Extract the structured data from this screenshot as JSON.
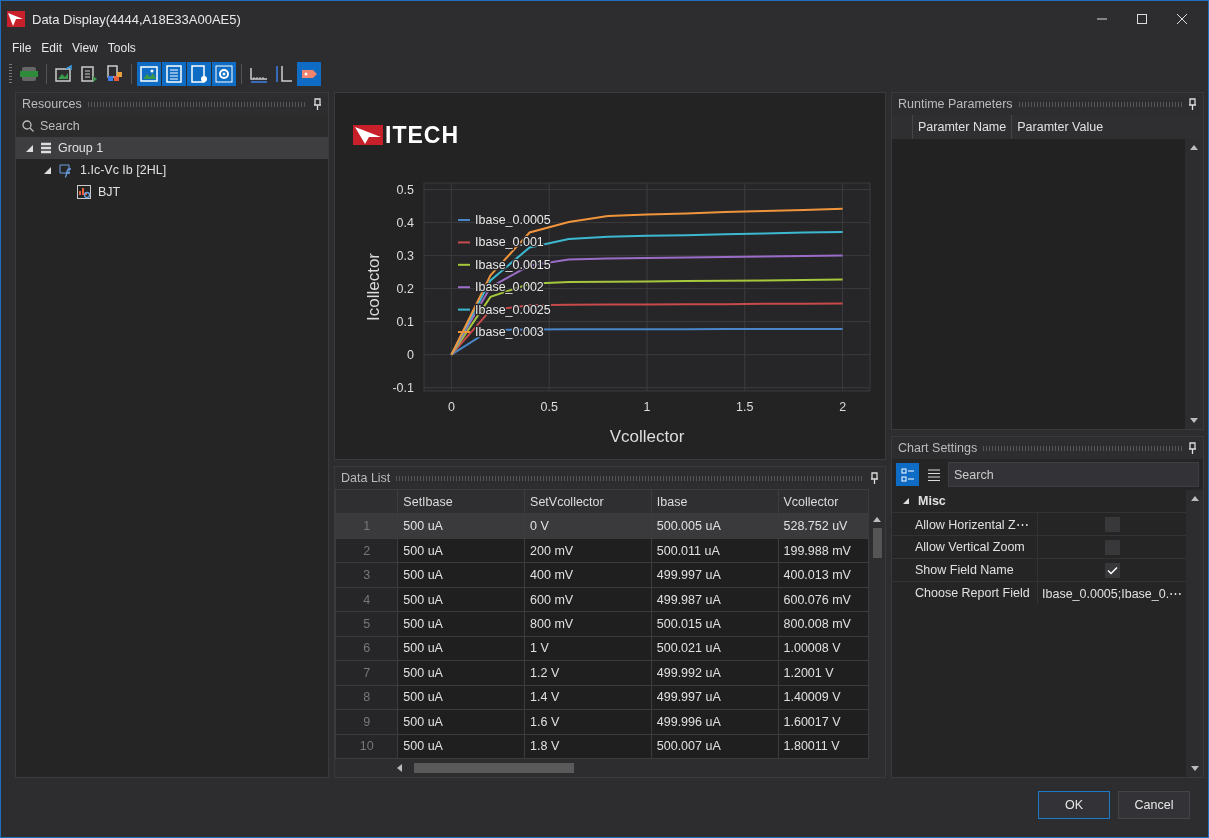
{
  "window": {
    "title": "Data Display(4444,A18E33A00AE5)"
  },
  "menu": [
    "File",
    "Edit",
    "View",
    "Tools"
  ],
  "toolbar": [
    {
      "on": false
    },
    {
      "on": false
    },
    {
      "on": false
    },
    {
      "on": false
    },
    {
      "on": true
    },
    {
      "on": true
    },
    {
      "on": true
    },
    {
      "on": true
    },
    {
      "on": false
    },
    {
      "on": false
    },
    {
      "on": true
    }
  ],
  "resources": {
    "title": "Resources",
    "search": {
      "placeholder": "Search"
    },
    "tree": [
      {
        "kind": "group",
        "label": "Group 1",
        "selected": true,
        "expanded": true,
        "children": [
          {
            "kind": "test",
            "label": "1.Ic-Vc Ib [2HL]",
            "selected": false,
            "expanded": true,
            "children": [
              {
                "kind": "chart",
                "label": "BJT",
                "selected": false
              }
            ]
          }
        ]
      }
    ]
  },
  "chart_panel": {
    "logo": "ITECH",
    "chart_data": {
      "type": "line",
      "grid": true,
      "legend": true,
      "xlabel": "Vcollector",
      "ylabel": "Icollector",
      "x": [
        0,
        0.2,
        0.4,
        0.6,
        0.8,
        1,
        1.2,
        1.4,
        1.6,
        1.8,
        2
      ],
      "xlim": [
        -0.14,
        2.14
      ],
      "ylim": [
        -0.11,
        0.52
      ],
      "xticks": [
        0,
        0.5,
        1,
        1.5,
        2
      ],
      "yticks": [
        -0.1,
        0,
        0.1,
        0.2,
        0.3,
        0.4,
        0.5
      ],
      "series": [
        {
          "name": "Ibase_0.0005",
          "color": "#4a86c8",
          "values": [
            0,
            0.075,
            0.076,
            0.077,
            0.077,
            0.077,
            0.077,
            0.078,
            0.078,
            0.078,
            0.078
          ]
        },
        {
          "name": "Ibase_0.001",
          "color": "#c84a4a",
          "values": [
            0,
            0.135,
            0.15,
            0.151,
            0.152,
            0.152,
            0.153,
            0.153,
            0.154,
            0.154,
            0.155
          ]
        },
        {
          "name": "Ibase_0.0015",
          "color": "#a6c83c",
          "values": [
            0,
            0.175,
            0.215,
            0.22,
            0.221,
            0.222,
            0.223,
            0.224,
            0.225,
            0.226,
            0.228
          ]
        },
        {
          "name": "Ibase_0.002",
          "color": "#9a6cc8",
          "values": [
            0,
            0.205,
            0.27,
            0.288,
            0.291,
            0.293,
            0.294,
            0.296,
            0.297,
            0.299,
            0.3
          ]
        },
        {
          "name": "Ibase_0.0025",
          "color": "#3cb8d0",
          "values": [
            0,
            0.225,
            0.325,
            0.35,
            0.357,
            0.36,
            0.362,
            0.365,
            0.367,
            0.37,
            0.372
          ]
        },
        {
          "name": "Ibase_0.003",
          "color": "#f0943c",
          "values": [
            0,
            0.24,
            0.37,
            0.402,
            0.42,
            0.425,
            0.428,
            0.432,
            0.435,
            0.438,
            0.442
          ]
        }
      ]
    }
  },
  "data_list": {
    "title": "Data List",
    "columns": [
      "SetIbase",
      "SetVcollector",
      "Ibase",
      "Vcollector"
    ],
    "rows": [
      {
        "index": "1",
        "selected": true,
        "cells": [
          "500 uA",
          "0 V",
          "500.005 uA",
          "528.752 uV"
        ]
      },
      {
        "index": "2",
        "selected": false,
        "cells": [
          "500 uA",
          "200 mV",
          "500.011 uA",
          "199.988 mV"
        ]
      },
      {
        "index": "3",
        "selected": false,
        "cells": [
          "500 uA",
          "400 mV",
          "499.997 uA",
          "400.013 mV"
        ]
      },
      {
        "index": "4",
        "selected": false,
        "cells": [
          "500 uA",
          "600 mV",
          "499.987 uA",
          "600.076 mV"
        ]
      },
      {
        "index": "5",
        "selected": false,
        "cells": [
          "500 uA",
          "800 mV",
          "500.015 uA",
          "800.008 mV"
        ]
      },
      {
        "index": "6",
        "selected": false,
        "cells": [
          "500 uA",
          "1 V",
          "500.021 uA",
          "1.00008 V"
        ]
      },
      {
        "index": "7",
        "selected": false,
        "cells": [
          "500 uA",
          "1.2 V",
          "499.992 uA",
          "1.2001 V"
        ]
      },
      {
        "index": "8",
        "selected": false,
        "cells": [
          "500 uA",
          "1.4 V",
          "499.997 uA",
          "1.40009 V"
        ]
      },
      {
        "index": "9",
        "selected": false,
        "cells": [
          "500 uA",
          "1.6 V",
          "499.996 uA",
          "1.60017 V"
        ]
      },
      {
        "index": "10",
        "selected": false,
        "cells": [
          "500 uA",
          "1.8 V",
          "500.007 uA",
          "1.80011 V"
        ]
      }
    ]
  },
  "runtime_parameters": {
    "title": "Runtime Parameters",
    "columns": [
      "Paramter Name",
      "Paramter Value"
    ]
  },
  "chart_settings": {
    "title": "Chart Settings",
    "views": [
      {
        "kind": "categorized",
        "selected": true
      },
      {
        "kind": "alphabetical",
        "selected": false
      }
    ],
    "search": {
      "placeholder": "Search"
    },
    "category": {
      "label": "Misc",
      "expanded": true
    },
    "properties": [
      {
        "kind": "checkbox",
        "name": "Allow Horizental Z⋯",
        "checked": false
      },
      {
        "kind": "checkbox",
        "name": "Allow Vertical Zoom",
        "checked": false
      },
      {
        "kind": "checkbox",
        "name": "Show Field Name",
        "checked": true
      },
      {
        "kind": "text",
        "name": "Choose Report Field",
        "value": "Ibase_0.0005;Ibase_0.⋯"
      }
    ]
  },
  "buttons": [
    {
      "label": "OK",
      "selected": true
    },
    {
      "label": "Cancel",
      "selected": false
    }
  ]
}
